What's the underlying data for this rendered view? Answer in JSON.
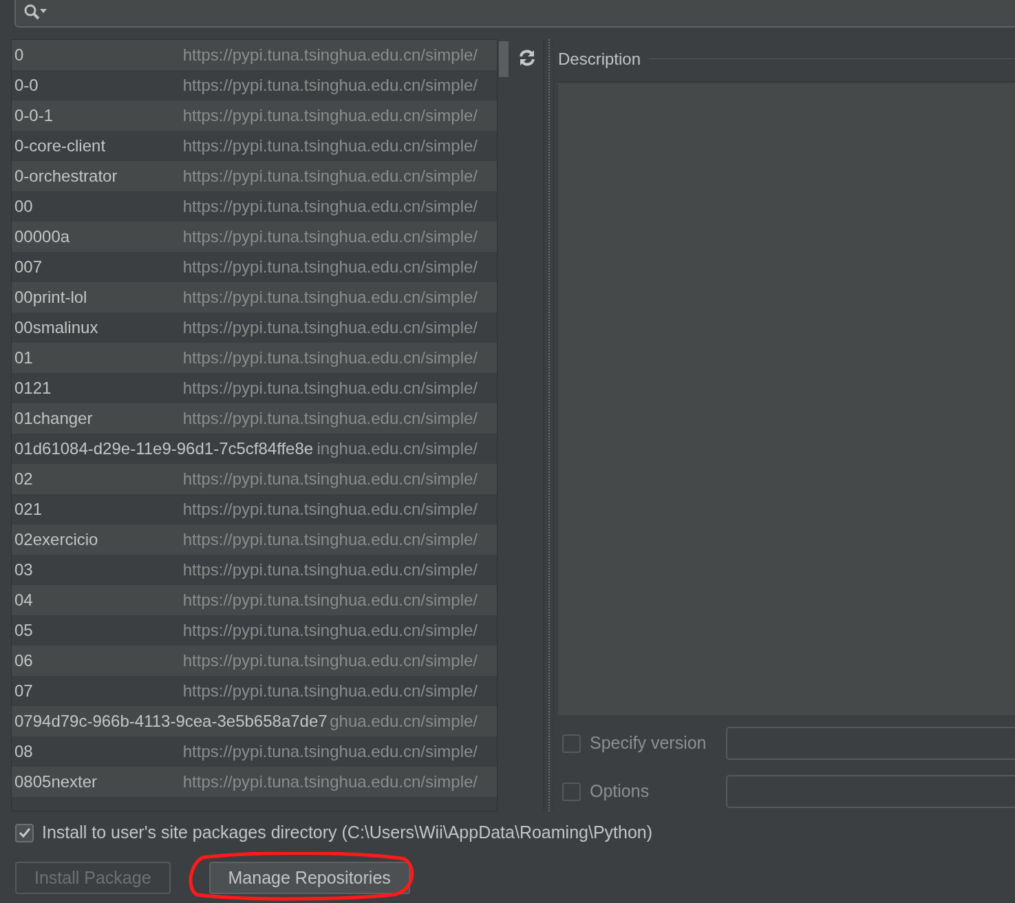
{
  "packages": [
    {
      "name": "0",
      "repository": "https://pypi.tuna.tsinghua.edu.cn/simple/"
    },
    {
      "name": "0-0",
      "repository": "https://pypi.tuna.tsinghua.edu.cn/simple/"
    },
    {
      "name": "0-0-1",
      "repository": "https://pypi.tuna.tsinghua.edu.cn/simple/"
    },
    {
      "name": "0-core-client",
      "repository": "https://pypi.tuna.tsinghua.edu.cn/simple/"
    },
    {
      "name": "0-orchestrator",
      "repository": "https://pypi.tuna.tsinghua.edu.cn/simple/"
    },
    {
      "name": "00",
      "repository": "https://pypi.tuna.tsinghua.edu.cn/simple/"
    },
    {
      "name": "00000a",
      "repository": "https://pypi.tuna.tsinghua.edu.cn/simple/"
    },
    {
      "name": "007",
      "repository": "https://pypi.tuna.tsinghua.edu.cn/simple/"
    },
    {
      "name": "00print-lol",
      "repository": "https://pypi.tuna.tsinghua.edu.cn/simple/"
    },
    {
      "name": "00smalinux",
      "repository": "https://pypi.tuna.tsinghua.edu.cn/simple/"
    },
    {
      "name": "01",
      "repository": "https://pypi.tuna.tsinghua.edu.cn/simple/"
    },
    {
      "name": "0121",
      "repository": "https://pypi.tuna.tsinghua.edu.cn/simple/"
    },
    {
      "name": "01changer",
      "repository": "https://pypi.tuna.tsinghua.edu.cn/simple/"
    },
    {
      "name": "01d61084-d29e-11e9-96d1-7c5cf84ffe8e",
      "repository": "inghua.edu.cn/simple/"
    },
    {
      "name": "02",
      "repository": "https://pypi.tuna.tsinghua.edu.cn/simple/"
    },
    {
      "name": "021",
      "repository": "https://pypi.tuna.tsinghua.edu.cn/simple/"
    },
    {
      "name": "02exercicio",
      "repository": "https://pypi.tuna.tsinghua.edu.cn/simple/"
    },
    {
      "name": "03",
      "repository": "https://pypi.tuna.tsinghua.edu.cn/simple/"
    },
    {
      "name": "04",
      "repository": "https://pypi.tuna.tsinghua.edu.cn/simple/"
    },
    {
      "name": "05",
      "repository": "https://pypi.tuna.tsinghua.edu.cn/simple/"
    },
    {
      "name": "06",
      "repository": "https://pypi.tuna.tsinghua.edu.cn/simple/"
    },
    {
      "name": "07",
      "repository": "https://pypi.tuna.tsinghua.edu.cn/simple/"
    },
    {
      "name": "0794d79c-966b-4113-9cea-3e5b658a7de7",
      "repository": "ghua.edu.cn/simple/"
    },
    {
      "name": "08",
      "repository": "https://pypi.tuna.tsinghua.edu.cn/simple/"
    },
    {
      "name": "0805nexter",
      "repository": "https://pypi.tuna.tsinghua.edu.cn/simple/"
    }
  ],
  "description": {
    "title": "Description"
  },
  "options": [
    {
      "label": "Specify version",
      "checked": false
    },
    {
      "label": "Options",
      "checked": false
    }
  ],
  "install_to_user": {
    "label": "Install to user's site packages directory (C:\\Users\\Wii\\AppData\\Roaming\\Python)",
    "checked": true
  },
  "buttons": [
    {
      "label": "Install Package",
      "disabled": true
    },
    {
      "label": "Manage Repositories",
      "disabled": false
    }
  ]
}
